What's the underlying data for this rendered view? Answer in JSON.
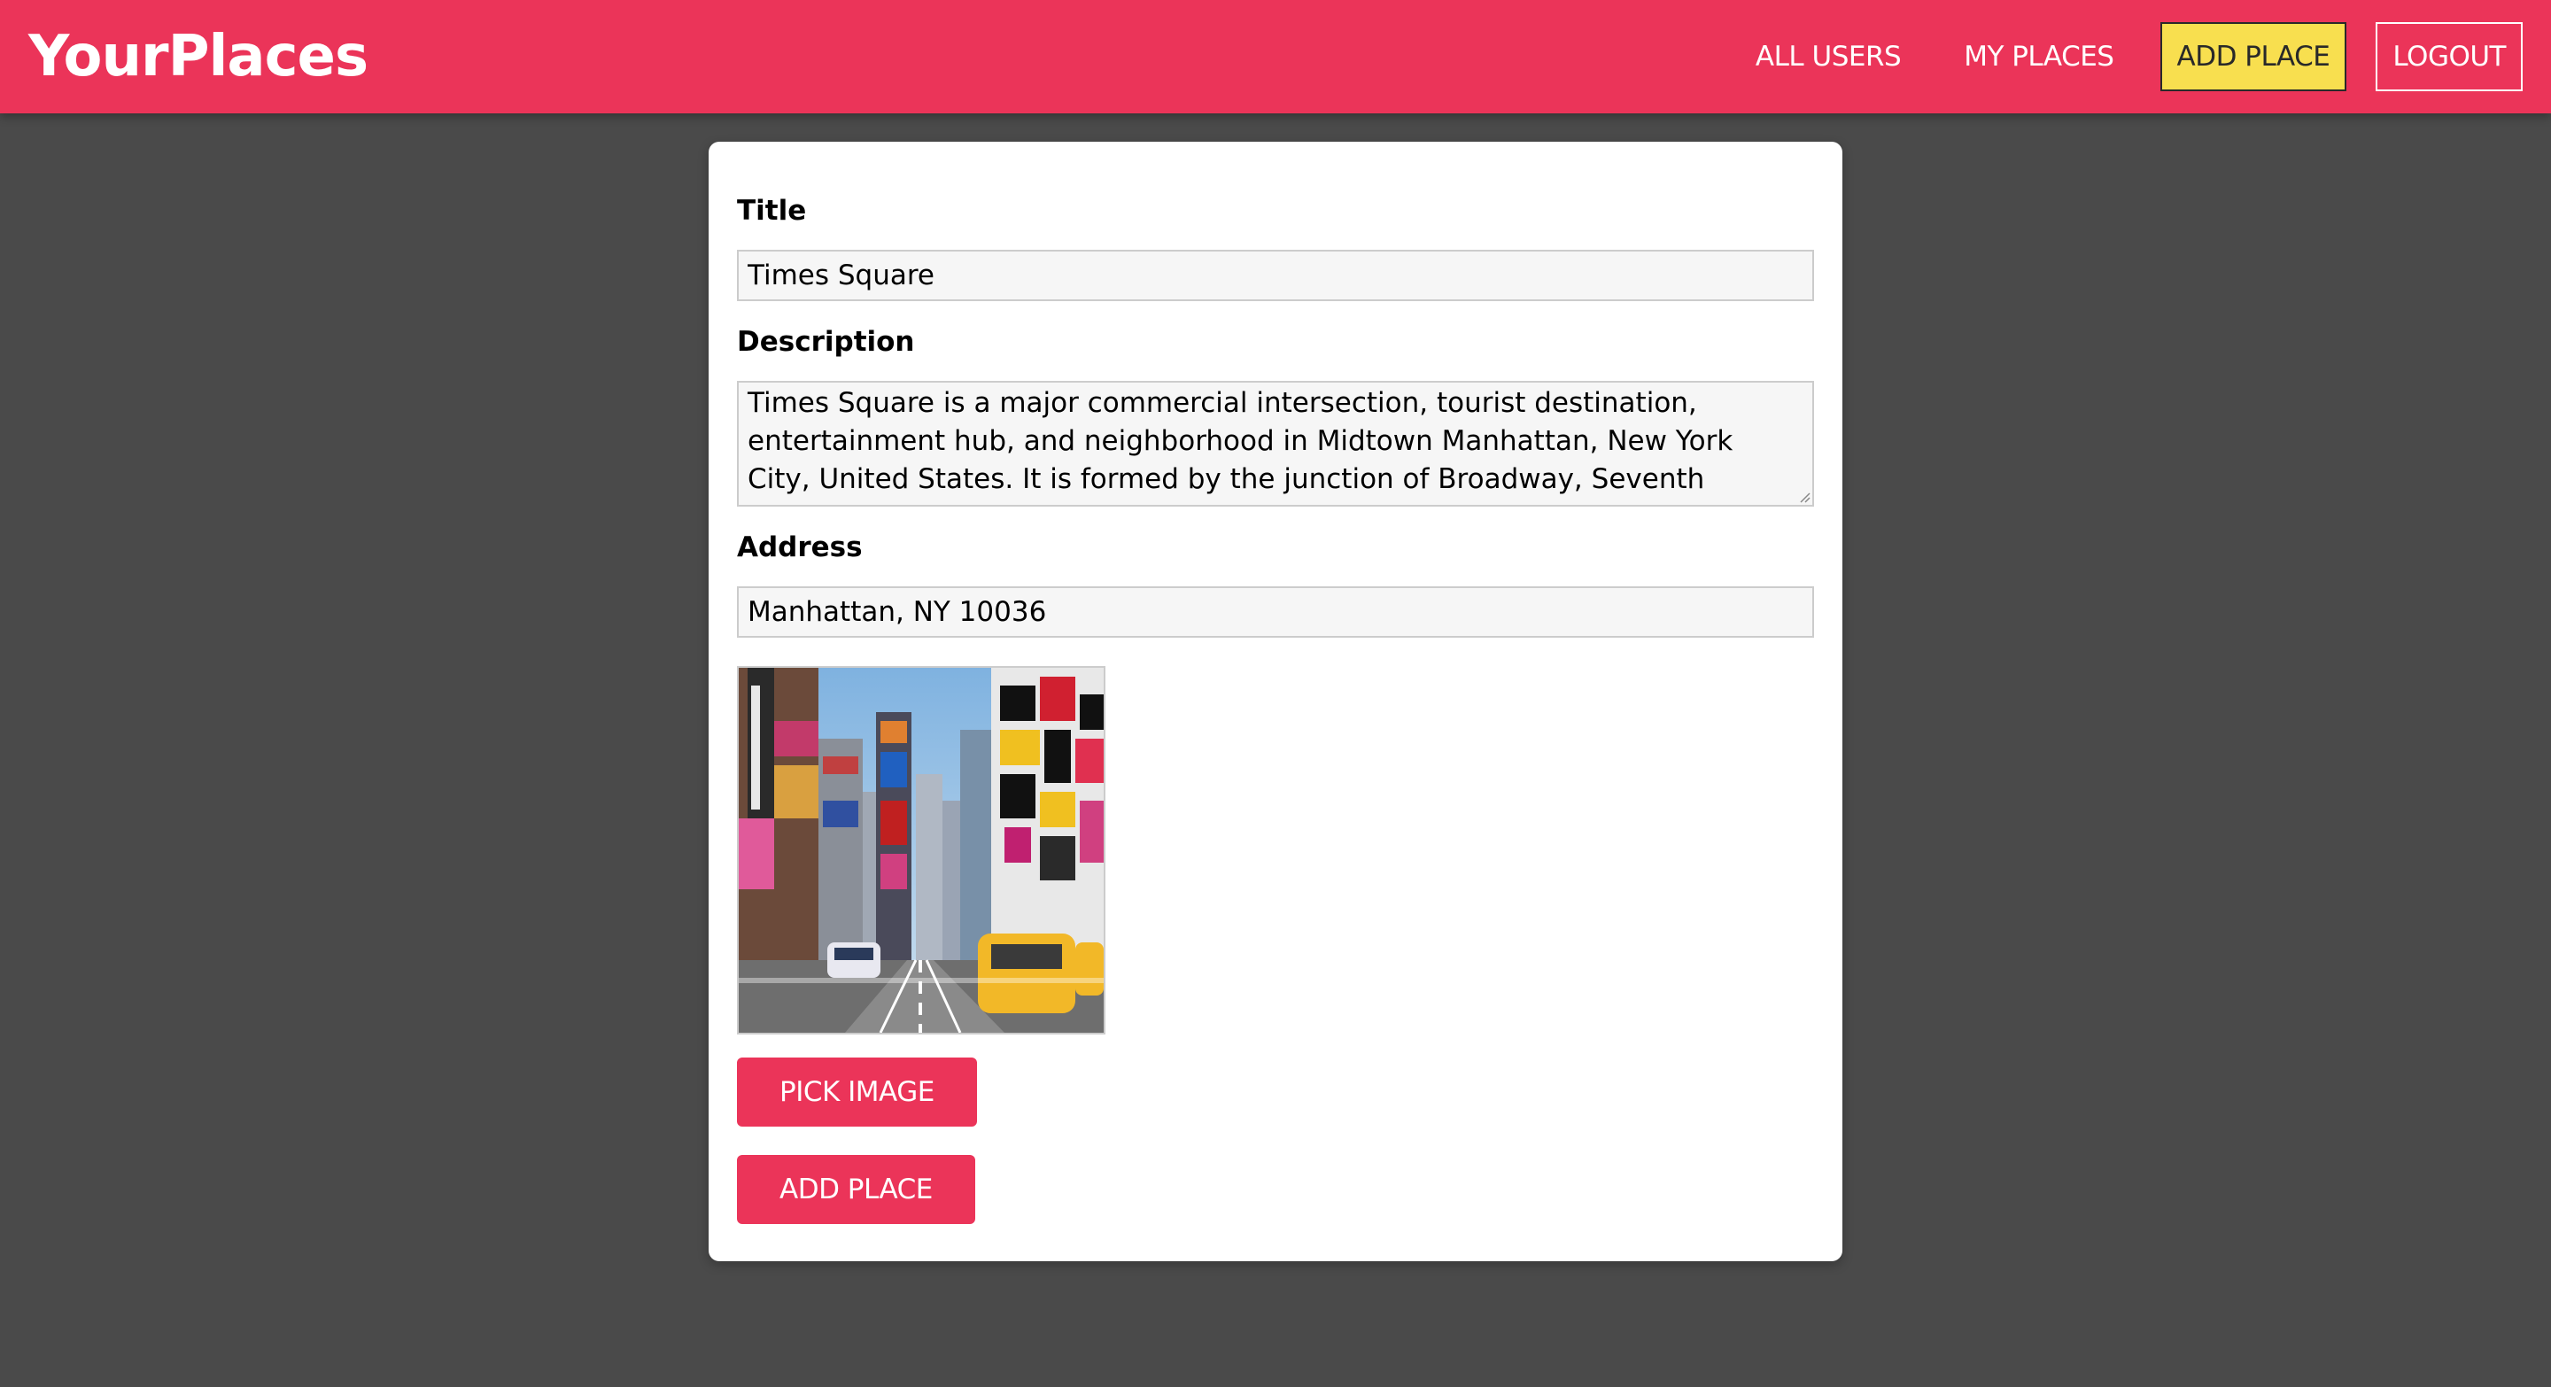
{
  "app": {
    "title": "YourPlaces"
  },
  "nav": {
    "items": [
      {
        "label": "ALL USERS"
      },
      {
        "label": "MY PLACES"
      },
      {
        "label": "ADD PLACE"
      },
      {
        "label": "LOGOUT"
      }
    ]
  },
  "form": {
    "title": {
      "label": "Title",
      "value": "Times Square"
    },
    "description": {
      "label": "Description",
      "value": "Times Square is a major commercial intersection, tourist destination, entertainment hub, and neighborhood in Midtown Manhattan, New York City, United States. It is formed by the junction of Broadway, Seventh Avenue, and"
    },
    "address": {
      "label": "Address",
      "value": "Manhattan, NY 10036"
    },
    "pick_image_label": "PICK IMAGE",
    "submit_label": "ADD PLACE"
  },
  "colors": {
    "brand": "#eb3459",
    "active_nav": "#f8df4f",
    "background": "#4a4a4a"
  },
  "icons": {
    "resize": "resize-grip-icon"
  }
}
